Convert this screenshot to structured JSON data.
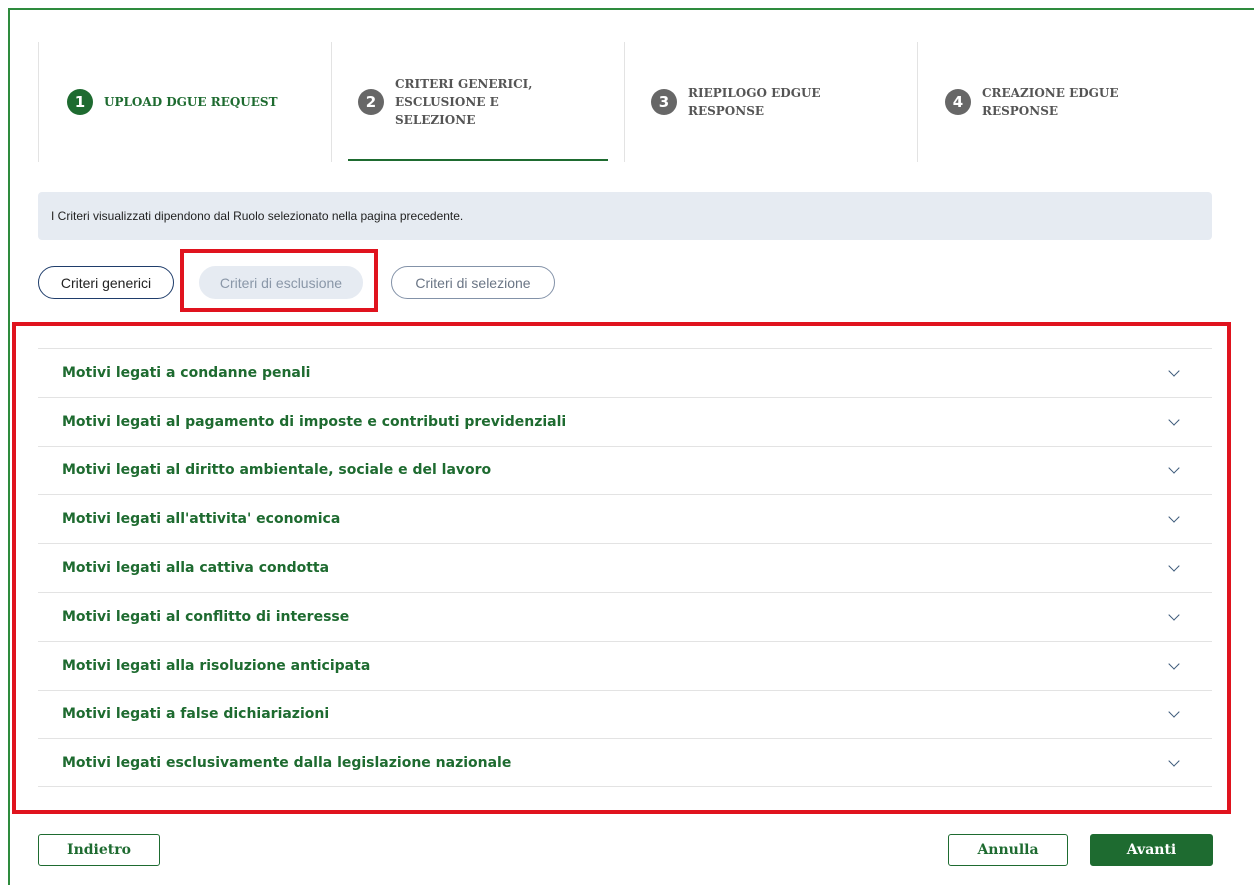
{
  "stepper": {
    "steps": [
      {
        "number": "1",
        "label": "UPLOAD DGUE REQUEST",
        "state": "active"
      },
      {
        "number": "2",
        "label": "CRITERI GENERICI, ESCLUSIONE E SELEZIONE",
        "state": "current"
      },
      {
        "number": "3",
        "label": "RIEPILOGO EDGUE RESPONSE",
        "state": "inactive"
      },
      {
        "number": "4",
        "label": "CREAZIONE EDGUE RESPONSE",
        "state": "inactive"
      }
    ]
  },
  "info": {
    "text": "I Criteri visualizzati dipendono dal Ruolo selezionato nella pagina precedente."
  },
  "tabs": {
    "generici": "Criteri generici",
    "esclusione": "Criteri di esclusione",
    "selezione": "Criteri di selezione"
  },
  "accordion": {
    "items": [
      "Motivi legati a condanne penali",
      "Motivi legati al pagamento di imposte e contributi previdenziali",
      "Motivi legati al diritto ambientale, sociale e del lavoro",
      "Motivi legati all'attivita' economica",
      "Motivi legati alla cattiva condotta",
      "Motivi legati al conflitto di interesse",
      "Motivi legati alla risoluzione anticipata",
      "Motivi legati a false dichiariazioni",
      "Motivi legati esclusivamente dalla legislazione nazionale"
    ]
  },
  "footer": {
    "back": "Indietro",
    "cancel": "Annulla",
    "next": "Avanti"
  },
  "colors": {
    "brand_green": "#1e6b30",
    "highlight_red": "#e0131e",
    "info_bg": "#e6ebf2"
  },
  "icons": {
    "accordion_toggle": "chevron-down-icon"
  }
}
